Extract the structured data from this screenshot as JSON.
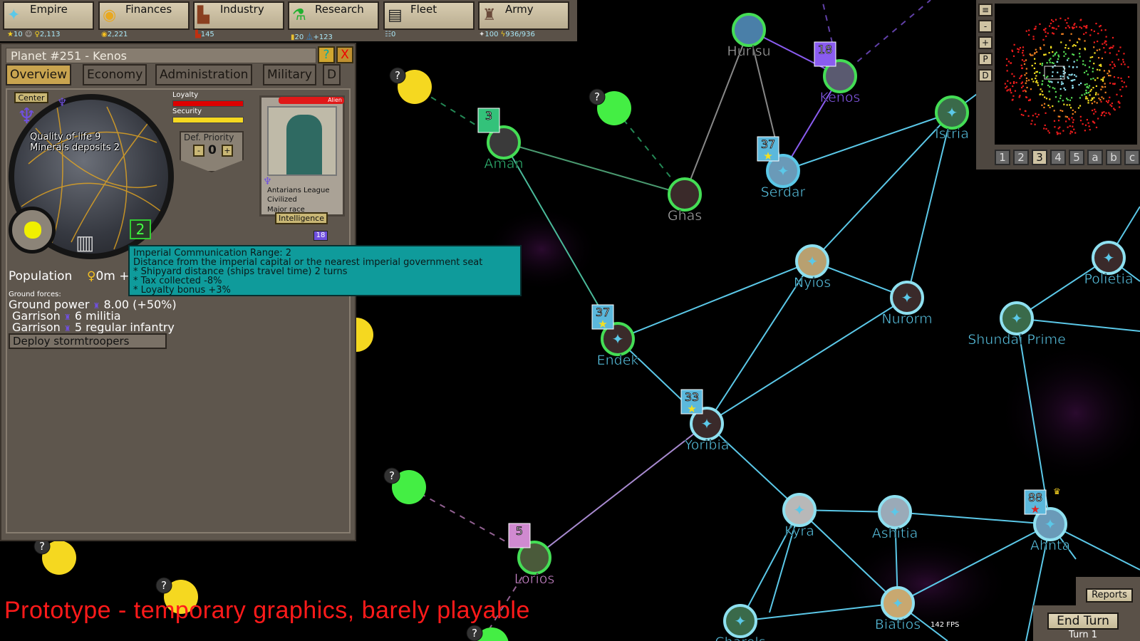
{
  "topbar": {
    "tabs": [
      {
        "label": "Empire",
        "icon": "eagle-icon"
      },
      {
        "label": "Finances",
        "icon": "coin-icon"
      },
      {
        "label": "Industry",
        "icon": "factory-icon"
      },
      {
        "label": "Research",
        "icon": "flask-icon"
      },
      {
        "label": "Fleet",
        "icon": "ships-icon"
      },
      {
        "label": "Army",
        "icon": "soldier-icon"
      }
    ],
    "stats": {
      "stars": "10",
      "population": "2,113",
      "credits": "2,221",
      "industry": "145",
      "research_docs": "20",
      "research": "+123",
      "fleet": "0",
      "army": "100",
      "energy": "936/936"
    }
  },
  "panel": {
    "title": "Planet #251 - Kenos",
    "help": "?",
    "close": "X",
    "tabs": [
      "Overview",
      "Economy",
      "Administration",
      "Military",
      "D"
    ],
    "center": "Center",
    "quality": "Quality of life 9",
    "minerals": "Minerals deposits 2",
    "loyalty_label": "Loyalty",
    "security_label": "Security",
    "loyalty_level": 1.0,
    "security_level": 1.0,
    "def_priority_label": "Def. Priority",
    "def_minus": "-",
    "def_value": "0",
    "def_plus": "+",
    "alien": "Alien",
    "race": [
      "Antarians League",
      "Civilized",
      "Major race"
    ],
    "intelligence": "Intelligence",
    "comm_range": "2",
    "fleet_badge": "18",
    "population_label": "Population",
    "population_value": "0m",
    "population_plus": "+",
    "ground_label": "Ground forces:",
    "ground_power": "Ground power",
    "ground_power_value": "8.00 (+50%)",
    "garrisons": [
      {
        "label": "Garrison",
        "value": "6 militia"
      },
      {
        "label": "Garrison",
        "value": "5 regular infantry"
      }
    ],
    "deploy": "Deploy stormtroopers"
  },
  "tooltip": [
    "Imperial Communication Range: 2",
    "Distance from the imperial capital or the nearest imperial government seat",
    "* Shipyard distance (ships travel time) 2 turns",
    "* Tax collected -8%",
    "* Loyalty bonus +3%"
  ],
  "map": {
    "colors": {
      "imperial": "#5bc8e8",
      "green": "#33c27a",
      "purple": "#8a5cf0",
      "pink": "#d08ad0",
      "grey": "#b0b0b0"
    },
    "planets": [
      {
        "name": "Hurisu",
        "owner": "grey"
      },
      {
        "name": "Kenos",
        "owner": "purple",
        "badge": "18"
      },
      {
        "name": "Aman",
        "owner": "green",
        "badge": "3"
      },
      {
        "name": "Ghas",
        "owner": "grey"
      },
      {
        "name": "Serdar",
        "owner": "imperial",
        "badge": "37"
      },
      {
        "name": "Istria",
        "owner": "imperial"
      },
      {
        "name": "Nyios",
        "owner": "imperial"
      },
      {
        "name": "Nurorm",
        "owner": "imperial"
      },
      {
        "name": "Polietia",
        "owner": "imperial"
      },
      {
        "name": "Shundai Prime",
        "owner": "imperial"
      },
      {
        "name": "Endek",
        "owner": "imperial",
        "badge": "37"
      },
      {
        "name": "Yoribia",
        "owner": "imperial",
        "badge": "33"
      },
      {
        "name": "Kyra",
        "owner": "imperial"
      },
      {
        "name": "Ashitia",
        "owner": "imperial"
      },
      {
        "name": "Ahnta",
        "owner": "imperial",
        "badge": "88"
      },
      {
        "name": "Lorios",
        "owner": "pink",
        "badge": "5"
      },
      {
        "name": "Biatios",
        "owner": "imperial"
      },
      {
        "name": "Charels",
        "owner": "imperial"
      }
    ],
    "unknown_marker": "?"
  },
  "minimap": {
    "buttons": [
      "≡",
      "-",
      "+",
      "P",
      "D"
    ],
    "tabs": [
      "1",
      "2",
      "3",
      "4",
      "5",
      "a",
      "b",
      "c"
    ],
    "active_tab": "3"
  },
  "footer": {
    "prototype": "Prototype - temporary graphics, barely playable",
    "fps": "142 FPS",
    "reports": "Reports",
    "end_turn": "End Turn",
    "turn": "Turn 1"
  }
}
